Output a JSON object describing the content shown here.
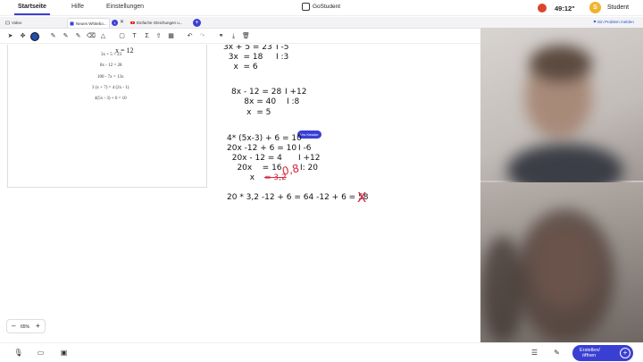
{
  "topbar": {
    "nav": [
      "Startseite",
      "Hilfe",
      "Einstellungen"
    ],
    "logo": "GoStudent",
    "timer": "49:12\"",
    "avatar_letter": "S",
    "username": "Student"
  },
  "tabs": {
    "items": [
      "Video",
      "Neues Whitebo...",
      "Einfache Gleichungen u..."
    ],
    "badge": "1",
    "problem_link": "Ein Problem melden"
  },
  "page": {
    "x_line": "x  = 12",
    "lines": [
      "3x + 5 = 23",
      "8x - 12 = 28",
      "100 - 7x = 13x",
      "3 (x + 7) = 4 (2x - 1)",
      "4(5x - 3) + 6 = 10"
    ]
  },
  "work": {
    "block1": [
      {
        "eq": "3x + 5 = 23",
        "op": "I -5"
      },
      {
        "eq": "  3x  = 18",
        "op": "I :3"
      },
      {
        "eq": "    x  = 6",
        "op": ""
      }
    ],
    "block2": [
      {
        "eq": "8x - 12 = 28",
        "op": "I +12"
      },
      {
        "eq": "     8x = 40",
        "op": "I :8"
      },
      {
        "eq": "      x  = 5",
        "op": ""
      }
    ],
    "block3": [
      {
        "eq": "4* (5x-3) + 6 = 10",
        "op": ""
      },
      {
        "eq": "20x -12 + 6 = 10",
        "op": "I -6"
      },
      {
        "eq": "  20x - 12 = 4",
        "op": "I +12"
      },
      {
        "eq": "    20x    = 16",
        "op": "I: 20"
      },
      {
        "eq": "         x",
        "op": ""
      }
    ],
    "crossed_value": "= 3,2",
    "correction": "0,8",
    "check": "20 * 3,2 -12 + 6 = 64 -12 + 6 = 58",
    "wrong_mark": "X",
    "cursor_user": "Urs Kessler"
  },
  "zoom": {
    "minus": "–",
    "value": "65%",
    "plus": "+"
  },
  "bottom": {
    "create_label_1": "Erstellen/",
    "create_label_2": "öffnen",
    "create_plus": "+"
  },
  "colors": {
    "accent": "#3a3fd4",
    "pen": "#1f4fa8",
    "correction": "#d7263d"
  }
}
